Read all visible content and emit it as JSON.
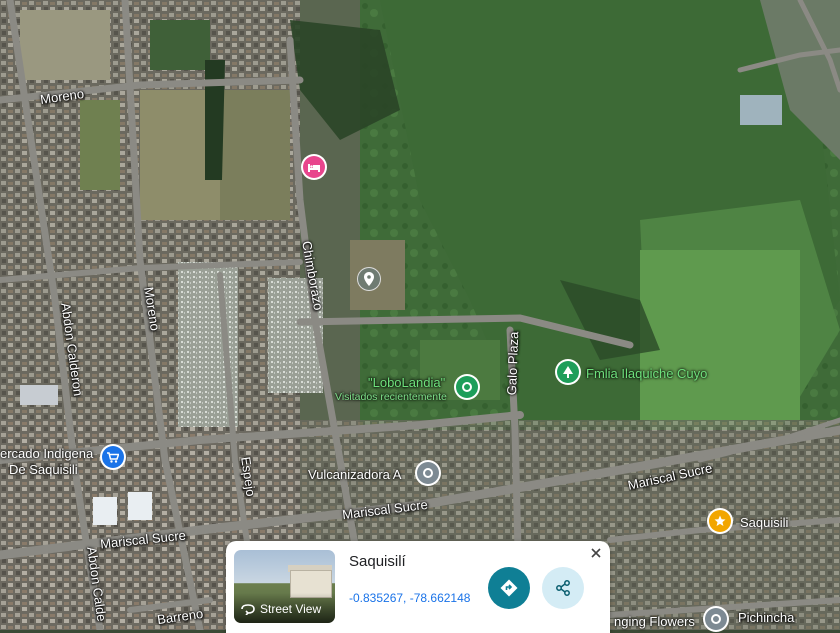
{
  "map": {
    "streets": {
      "moreno_top": "Moreno",
      "moreno_vertical": "Moreno",
      "chimborazo": "Chimborazo",
      "abdon_calderon": "Abdon Calderon",
      "abdon_calderon_bottom": "Abdon Calde",
      "galo_plaza": "Galo Plaza",
      "espejo": "Espejo",
      "mariscal_sucre_left": "Mariscal Sucre",
      "mariscal_sucre_center": "Mariscal Sucre",
      "mariscal_sucre_right": "Mariscal Sucre",
      "barreno": "Barreno",
      "pichincha": "Pichincha",
      "e_fragment": "E"
    },
    "places": {
      "lobolandia": "\"LoboLandia\"",
      "lobolandia_sub": "Visitados recientemente",
      "fmlia": "Fmlia Ilaquiche Cuyo",
      "vulcanizadora": "Vulcanizadora A",
      "mercado_line1": "ercado Indigena",
      "mercado_line2": "De Saquisili",
      "saquisili": "Saquisili",
      "flowers": "nging Flowers"
    },
    "icons": {
      "hotel": "hotel-icon",
      "dropped_pin": "dropped-pin-icon",
      "lobolandia": "place-pin-icon",
      "fmlia": "park-icon",
      "vulcanizadora": "place-pin-icon",
      "mercado": "shopping-cart-icon",
      "saquisili": "star-icon",
      "flowers": "place-pin-icon"
    },
    "colors": {
      "hotel_pin": "#e8458d",
      "green_pin": "#1e9e5a",
      "grey_pin": "#7d8a93",
      "blue_pin": "#1a73e8",
      "star_pin": "#f2a600"
    }
  },
  "info_card": {
    "title": "Saquisilí",
    "coordinates": "-0.835267, -78.662148",
    "street_view_label": "Street View",
    "close_icon": "close-icon",
    "directions_icon": "directions-icon",
    "share_icon": "share-icon"
  }
}
